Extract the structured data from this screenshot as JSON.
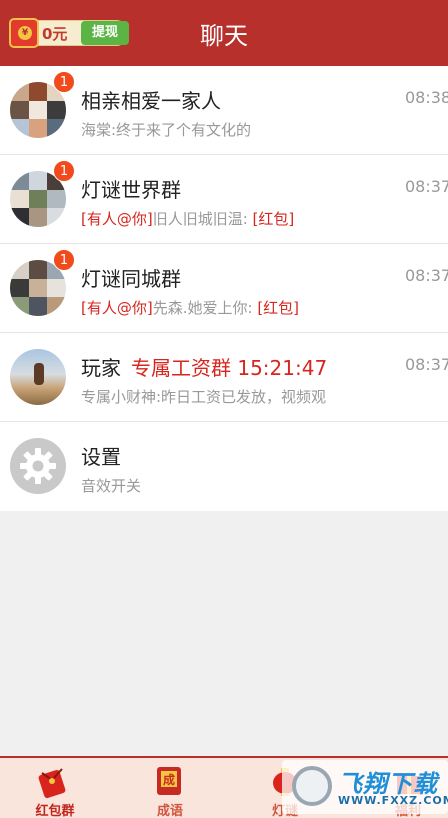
{
  "header": {
    "title": "聊天",
    "wallet_amount": "0元",
    "withdraw_label": "提现",
    "coin_symbol": "¥"
  },
  "chats": [
    {
      "name": "相亲相爱一家人",
      "time": "08:38",
      "badge": "1",
      "preview_mention": "",
      "preview_text": "海棠:终于来了个有文化的",
      "preview_tag": "",
      "avatar": "group-mosaic-icon"
    },
    {
      "name": "灯谜世界群",
      "time": "08:37",
      "badge": "1",
      "preview_mention": "[有人@你]",
      "preview_text": "旧人旧城旧温:",
      "preview_tag": " [红包]",
      "avatar": "group-mosaic-icon"
    },
    {
      "name": "灯谜同城群",
      "time": "08:37",
      "badge": "1",
      "preview_mention": "[有人@你]",
      "preview_text": "先森.她爱上你:",
      "preview_tag": " [红包]",
      "avatar": "group-mosaic-icon"
    },
    {
      "name": "玩家",
      "name_extra": "专属工资群  15:21:47",
      "time": "08:37",
      "preview_text": "专属小财神:昨日工资已发放，视频观",
      "avatar": "photo-avatar"
    },
    {
      "name": "设置",
      "preview_text": "音效开关",
      "avatar": "gear-icon"
    }
  ],
  "tabs": [
    {
      "label": "红包群",
      "icon": "red-envelope-icon",
      "active": true
    },
    {
      "label": "成语",
      "icon": "idiom-book-icon",
      "active": false
    },
    {
      "label": "灯谜",
      "icon": "lantern-icon",
      "active": false
    },
    {
      "label": "福利",
      "icon": "gift-icon",
      "active": false
    }
  ],
  "watermark": {
    "text": "飞翔下载",
    "url": "WWW.FXXZ.COM"
  },
  "colors": {
    "header": "#b7302c",
    "accent_red": "#d7261f",
    "badge": "#f04a1d",
    "tab_bar": "#f9e5dc"
  }
}
